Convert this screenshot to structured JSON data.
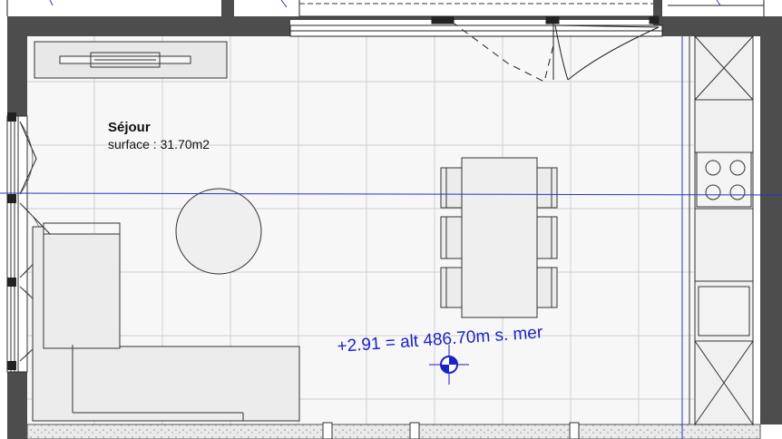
{
  "room": {
    "name": "Séjour",
    "surface_label": "surface : 31.70m2"
  },
  "elevation": {
    "label": "+2.91 = alt 486.70m s. mer"
  },
  "colors": {
    "wall": "#4a4a4a",
    "grid": "#c9c9c9",
    "floor": "#f6f6f6",
    "furniture_fill": "#efefef",
    "reference_line": "#2a33c9",
    "elevation_text": "#1a22c8"
  },
  "icons": {
    "elevation_marker": "crosshair-target-icon"
  }
}
